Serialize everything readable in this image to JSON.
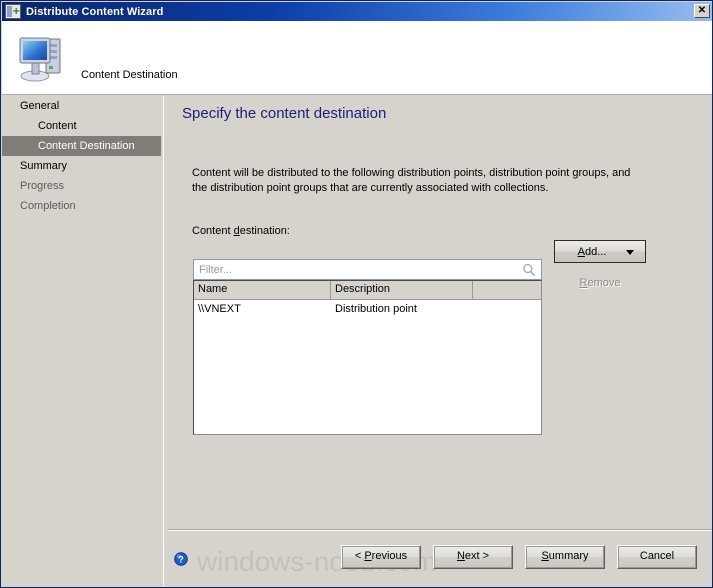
{
  "window": {
    "title": "Distribute Content Wizard",
    "title_icon": "wizard-icon",
    "close_label": "✕"
  },
  "banner": {
    "icon": "computer-icon",
    "title": "Content Destination"
  },
  "sidebar": {
    "items": [
      {
        "label": "General",
        "level": 0,
        "state": "normal"
      },
      {
        "label": "Content",
        "level": 1,
        "state": "normal"
      },
      {
        "label": "Content Destination",
        "level": 1,
        "state": "current"
      },
      {
        "label": "Summary",
        "level": 0,
        "state": "normal"
      },
      {
        "label": "Progress",
        "level": 0,
        "state": "dim"
      },
      {
        "label": "Completion",
        "level": 0,
        "state": "dim"
      }
    ]
  },
  "main": {
    "heading": "Specify the content destination",
    "description": "Content will be distributed to the following distribution points, distribution point groups, and the distribution point groups that are currently associated with collections.",
    "field_label_pre": "Content ",
    "field_label_key": "d",
    "field_label_post": "estination:",
    "filter": {
      "value": "",
      "placeholder": "Filter...",
      "icon": "search-icon"
    },
    "table": {
      "columns": [
        "Name",
        "Description",
        ""
      ],
      "rows": [
        [
          "\\\\VNEXT",
          "Distribution point",
          ""
        ]
      ]
    },
    "add_button": {
      "label": "Add...",
      "accesskey": "A",
      "label_pre": "",
      "label_post": "dd...",
      "dropdown_icon": "chevron-down-icon"
    },
    "remove_button": {
      "accesskey": "R",
      "label_post": "emove",
      "disabled": true
    }
  },
  "footer": {
    "help_icon": "help-icon",
    "buttons": [
      {
        "name": "previous",
        "pre": "< ",
        "key": "P",
        "post": "revious"
      },
      {
        "name": "next",
        "pre": "",
        "key": "N",
        "post": "ext >"
      },
      {
        "name": "summary",
        "pre": "",
        "key": "S",
        "post": "ummary"
      },
      {
        "name": "cancel",
        "pre": "",
        "key": "",
        "post": "Cancel"
      }
    ]
  },
  "watermark": "windows-noob.com",
  "colors": {
    "titlebar_start": "#0a246a",
    "titlebar_end": "#97bdf0",
    "dialog_bg": "#d6d3cd",
    "heading_blue": "#1d1d80",
    "selection_gray": "#807d79",
    "help_blue": "#1a5fc8"
  }
}
